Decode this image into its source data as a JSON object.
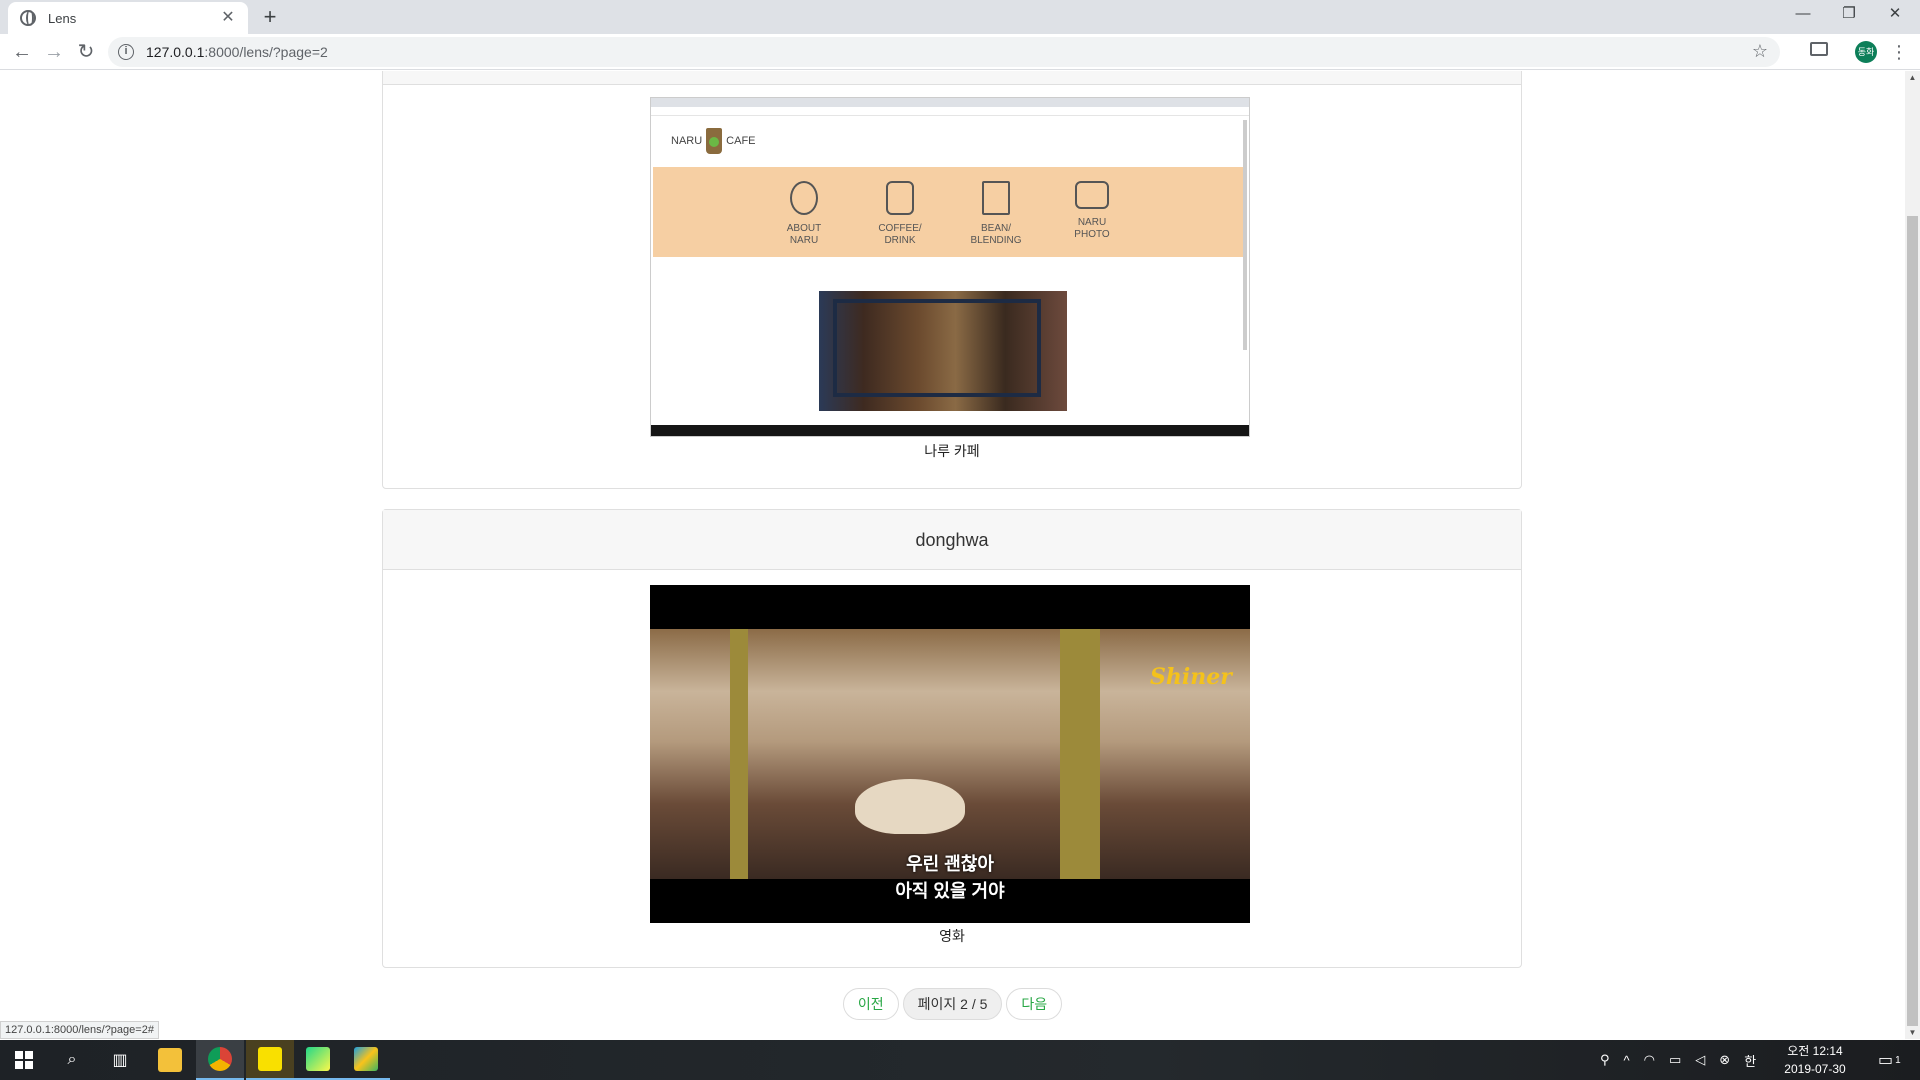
{
  "browser": {
    "tab_title": "Lens",
    "url_host": "127.0.0.1",
    "url_path": ":8000/lens/?page=2",
    "profile_initial": "동화",
    "status_url": "127.0.0.1:8000/lens/?page=2#"
  },
  "posts": [
    {
      "caption": "나루 카페",
      "screenshot": {
        "logo_left": "NARU",
        "logo_right": "CAFE",
        "menu": [
          {
            "line1": "ABOUT",
            "line2": "NARU"
          },
          {
            "line1": "COFFEE/",
            "line2": "DRINK"
          },
          {
            "line1": "BEAN/",
            "line2": "BLENDING"
          },
          {
            "line1": "NARU",
            "line2": "PHOTO"
          }
        ]
      }
    },
    {
      "author": "donghwa",
      "caption": "영화",
      "subtitle_line1": "우린 괜찮아",
      "subtitle_line2": "아직 있을 거야",
      "sign_text": "Shiner"
    }
  ],
  "pagination": {
    "prev": "이전",
    "current": "페이지 2 / 5",
    "next": "다음"
  },
  "taskbar": {
    "time": "오전 12:14",
    "date": "2019-07-30",
    "notification_count": "1"
  }
}
